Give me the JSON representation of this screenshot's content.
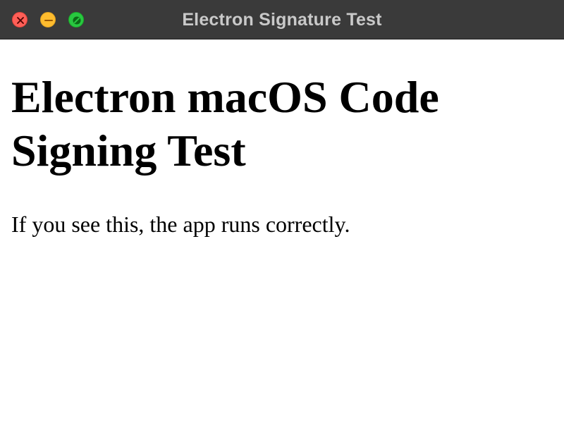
{
  "window": {
    "title": "Electron Signature Test",
    "controls": {
      "close_color": "#ff5f57",
      "minimize_color": "#febc2e",
      "maximize_color": "#28c840"
    }
  },
  "page": {
    "heading": "Electron macOS Code Signing Test",
    "message": "If you see this, the app runs correctly."
  }
}
